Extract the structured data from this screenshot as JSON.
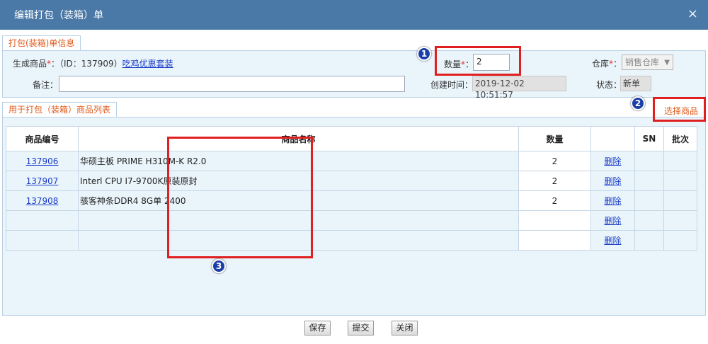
{
  "dialog": {
    "title": "编辑打包（装箱）单",
    "close_icon": "×"
  },
  "info_tab": {
    "label": "打包(装箱)单信息"
  },
  "form": {
    "product_label": "生成商品",
    "required_mark": "*",
    "product_id_text": "：（ID：137909）",
    "product_name": "吃鸡优惠套装",
    "note_label": "备注：",
    "note_value": "",
    "qty_label": "数量",
    "qty_colon": "：",
    "qty_value": "2",
    "created_label": "创建时间：",
    "created_value": "2019-12-02 10:51:57",
    "warehouse_label": "仓库",
    "warehouse_colon": "：",
    "warehouse_value": "销售仓库",
    "status_label": "状态：",
    "status_value": "新单"
  },
  "list_tab": {
    "label": "用于打包（装箱）商品列表"
  },
  "select_products_label": "选择商品",
  "annotations": {
    "badge1": "1",
    "badge2": "2",
    "badge3": "3"
  },
  "table": {
    "headers": {
      "code": "商品编号",
      "name": "商品名称",
      "qty": "数量",
      "action": "",
      "sn": "SN",
      "batch": "批次"
    },
    "rows": [
      {
        "code": "137906",
        "name": "华硕主板 PRIME H310M-K R2.0",
        "qty": "2",
        "action": "删除"
      },
      {
        "code": "137907",
        "name": "Interl CPU I7-9700K原装原封",
        "qty": "2",
        "action": "删除"
      },
      {
        "code": "137908",
        "name": "骇客神条DDR4 8G单 2400",
        "qty": "2",
        "action": "删除"
      },
      {
        "code": "",
        "name": "",
        "qty": "",
        "action": "删除"
      },
      {
        "code": "",
        "name": "",
        "qty": "",
        "action": "删除"
      }
    ]
  },
  "buttons": {
    "save": "保存",
    "submit": "提交",
    "close": "关闭"
  },
  "colors": {
    "titlebar": "#4a79a8",
    "panel": "#eaf5fb",
    "annotation_red": "#e02020",
    "badge": "#1b3fa6"
  }
}
